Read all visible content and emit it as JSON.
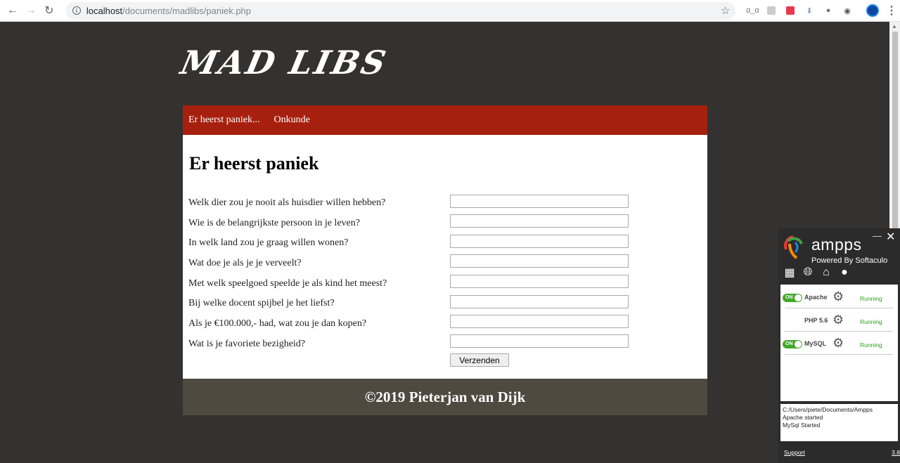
{
  "browser": {
    "url_host": "localhost",
    "url_path": "/documents/madlibs/paniek.php"
  },
  "site": {
    "logo": "MAD LIBS",
    "nav": [
      "Er heerst paniek...",
      "Onkunde"
    ],
    "heading": "Er heerst paniek",
    "questions": [
      "Welk dier zou je nooit als huisdier willen hebben?",
      "Wie is de belangrijkste persoon in je leven?",
      "In welk land zou je graag willen wonen?",
      "Wat doe je als je je verveelt?",
      "Met welk speelgoed speelde je als kind het meest?",
      "Bij welke docent spijbel je het liefst?",
      "Als je €100.000,- had, wat zou je dan kopen?",
      "Wat is je favoriete bezigheid?"
    ],
    "answers": [
      "",
      "",
      "",
      "",
      "",
      "",
      "",
      ""
    ],
    "submit_label": "Verzenden",
    "footer": "©2019 Pieterjan van Dijk"
  },
  "ampps": {
    "brand": "ampps",
    "powered": "Powered By Softaculo",
    "services": [
      {
        "name": "Apache",
        "toggle": "ON",
        "status": "Running"
      },
      {
        "name": "PHP 5.6",
        "toggle": "",
        "status": "Running"
      },
      {
        "name": "MySQL",
        "toggle": "ON",
        "status": "Running"
      }
    ],
    "log": [
      "C:/Users/piete/Documents/Ampps",
      "Apache started",
      "MySql Started"
    ],
    "support": "Support",
    "version": "3.8"
  },
  "colors": {
    "page_bg": "#343230",
    "nav_bg": "#a7200f",
    "footer_bg": "#4e4a40",
    "running": "#2e9e1b"
  }
}
